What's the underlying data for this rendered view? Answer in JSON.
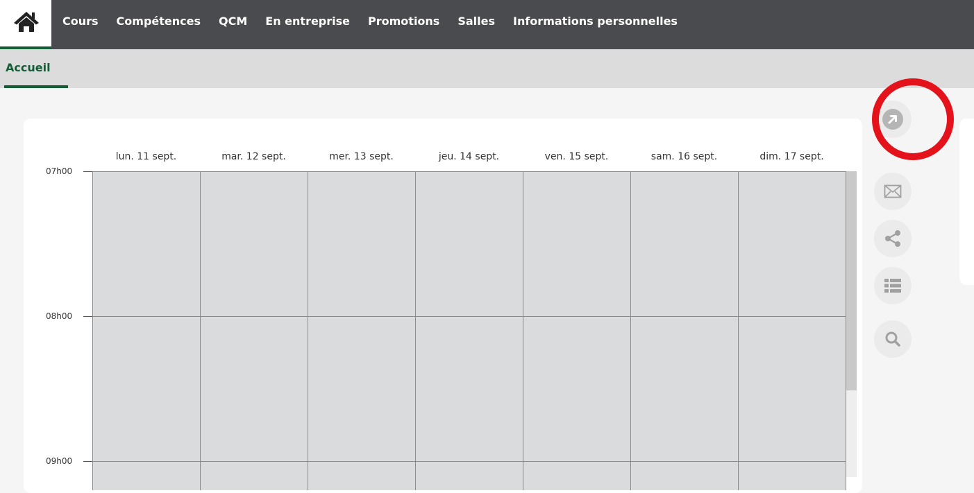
{
  "topnav": {
    "home_icon": "home-icon",
    "items": [
      "Cours",
      "Compétences",
      "QCM",
      "En entreprise",
      "Promotions",
      "Salles",
      "Informations personnelles"
    ]
  },
  "subnav": {
    "active_tab": "Accueil"
  },
  "calendar": {
    "days": [
      "lun. 11 sept.",
      "mar. 12 sept.",
      "mer. 13 sept.",
      "jeu. 14 sept.",
      "ven. 15 sept.",
      "sam. 16 sept.",
      "dim. 17 sept."
    ],
    "hours": [
      "07h00",
      "08h00",
      "09h00"
    ]
  },
  "actions": {
    "icons": [
      "external-link-icon",
      "mail-icon",
      "share-icon",
      "list-icon",
      "search-icon"
    ],
    "highlighted": "external-link-icon"
  },
  "colors": {
    "nav_bg": "#4a4b4f",
    "accent": "#145e36",
    "grid_fill": "#dadbdd",
    "highlight": "#e3121b"
  }
}
